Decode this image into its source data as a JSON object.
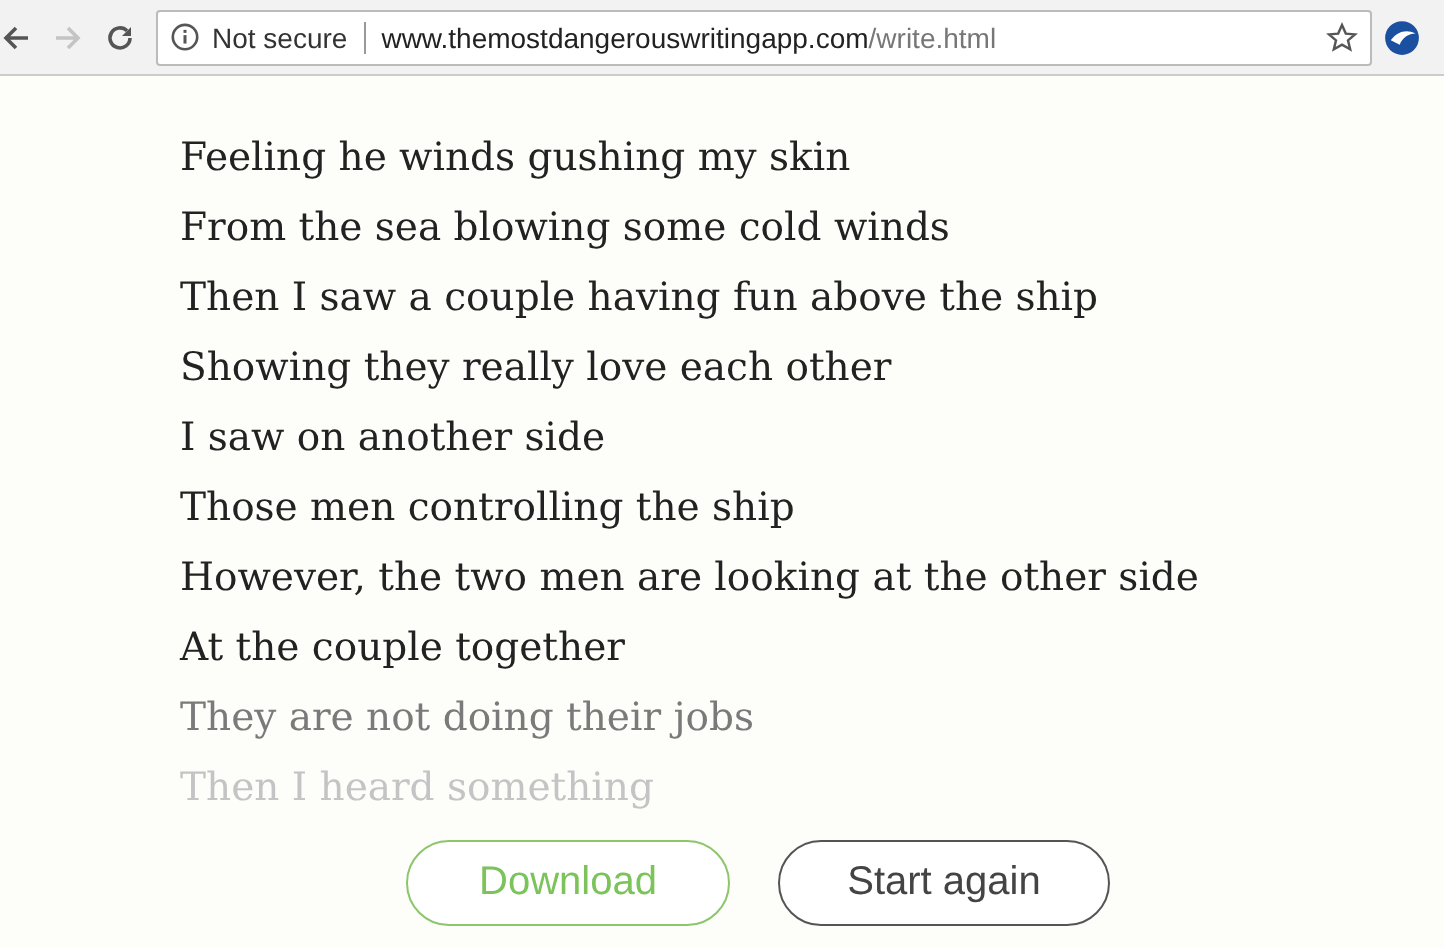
{
  "browser": {
    "security_label": "Not secure",
    "url_host": "www.themostdangerouswritingapp.com",
    "url_path": "/write.html",
    "forward_disabled": true
  },
  "lines": [
    {
      "text": "Feeling he winds gushing my skin",
      "kind": "normal"
    },
    {
      "text": "From the sea blowing some cold winds",
      "kind": "normal"
    },
    {
      "text": "Then I saw a couple having fun above the ship",
      "kind": "normal"
    },
    {
      "text": "Showing they really love each other",
      "kind": "normal"
    },
    {
      "text": "I saw on another side",
      "kind": "normal"
    },
    {
      "text": "Those men controlling the ship",
      "kind": "normal"
    },
    {
      "text": "However, the two men are looking at the other side",
      "kind": "normal"
    },
    {
      "text": "At the couple together",
      "kind": "normal"
    },
    {
      "text": "They are not doing their jobs",
      "kind": "faded"
    },
    {
      "text": "Then I heard something",
      "kind": "dim"
    }
  ],
  "buttons": [
    {
      "label": "Download",
      "kind": "download"
    },
    {
      "label": "Start again",
      "kind": "restart"
    }
  ]
}
